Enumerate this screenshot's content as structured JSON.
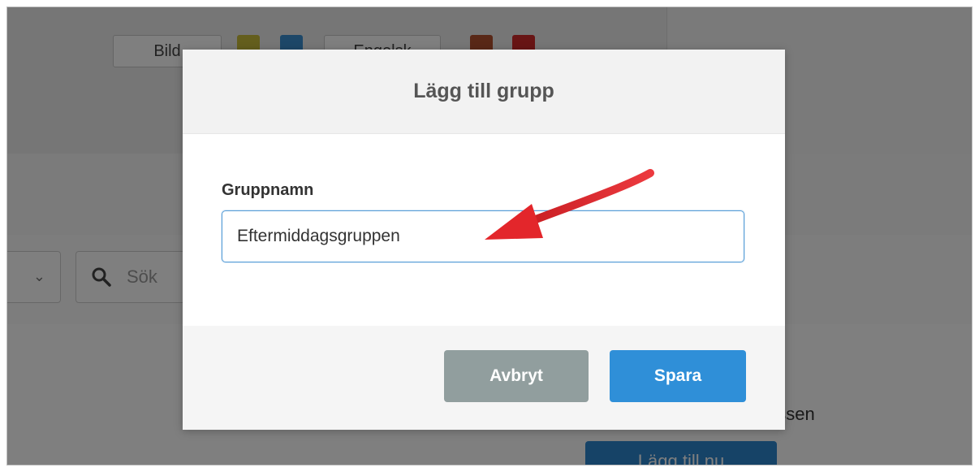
{
  "background": {
    "toolbar": {
      "bild_label": "Bild",
      "second_label": "Engelsk"
    },
    "search": {
      "placeholder": "Sök"
    },
    "side_text": "assen",
    "add_button_label": "Lägg till nu"
  },
  "dialog": {
    "title": "Lägg till grupp",
    "field_label": "Gruppnamn",
    "field_value": "Eftermiddagsgruppen",
    "cancel_label": "Avbryt",
    "save_label": "Spara"
  },
  "colors": {
    "save_button": "#2f8fd8",
    "cancel_button": "#919e9e",
    "annotation_arrow": "#e3262b"
  }
}
